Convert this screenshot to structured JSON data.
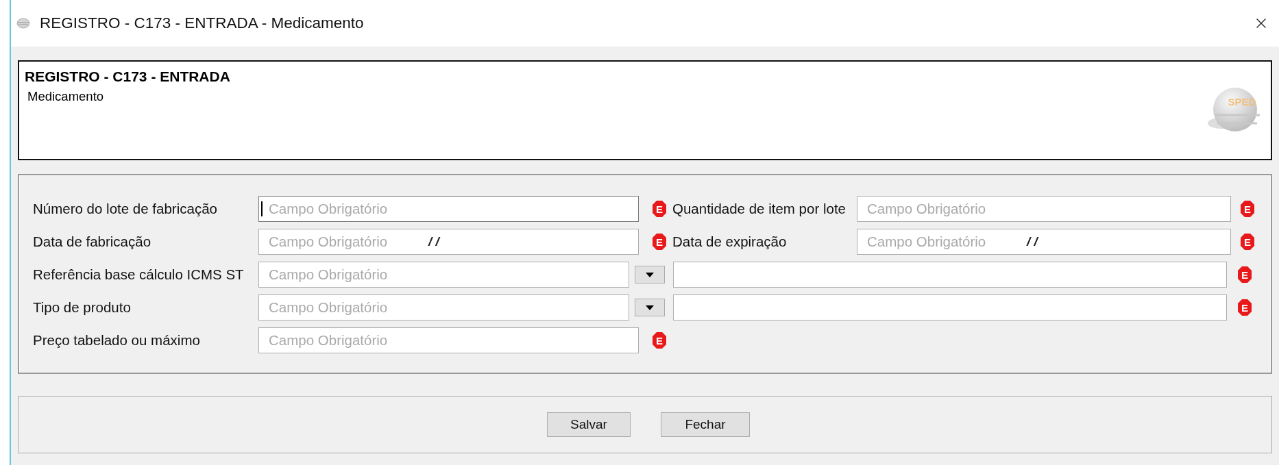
{
  "window": {
    "title": "REGISTRO - C173 - ENTRADA - Medicamento"
  },
  "header": {
    "title": "REGISTRO - C173 - ENTRADA",
    "subtitle": "Medicamento",
    "logo_text": "SPED"
  },
  "form": {
    "rows": [
      {
        "kind": "pair",
        "fields": [
          {
            "label": "Número do lote de fabricação",
            "placeholder": "Campo Obrigatório",
            "focused": true,
            "mark": "E"
          },
          {
            "label": "Quantidade de item por lote",
            "placeholder": "Campo Obrigatório",
            "focused": false,
            "mark": "E"
          }
        ]
      },
      {
        "kind": "pair",
        "fields": [
          {
            "label": "Data de fabricação",
            "placeholder": "Campo Obrigatório",
            "mask": "/ /",
            "focused": false,
            "mark": "E"
          },
          {
            "label": "Data de expiração",
            "placeholder": "Campo Obrigatório",
            "mask": "/ /",
            "focused": false,
            "mark": "E"
          }
        ]
      },
      {
        "kind": "combo",
        "label": "Referência base cálculo ICMS ST",
        "placeholder": "Campo Obrigatório",
        "mark": "E"
      },
      {
        "kind": "combo",
        "label": "Tipo de produto",
        "placeholder": "Campo Obrigatório",
        "mark": "E"
      },
      {
        "kind": "single",
        "label": "Preço tabelado ou máximo",
        "placeholder": "Campo Obrigatório",
        "mark": "E"
      }
    ]
  },
  "buttons": [
    "Salvar",
    "Fechar"
  ]
}
